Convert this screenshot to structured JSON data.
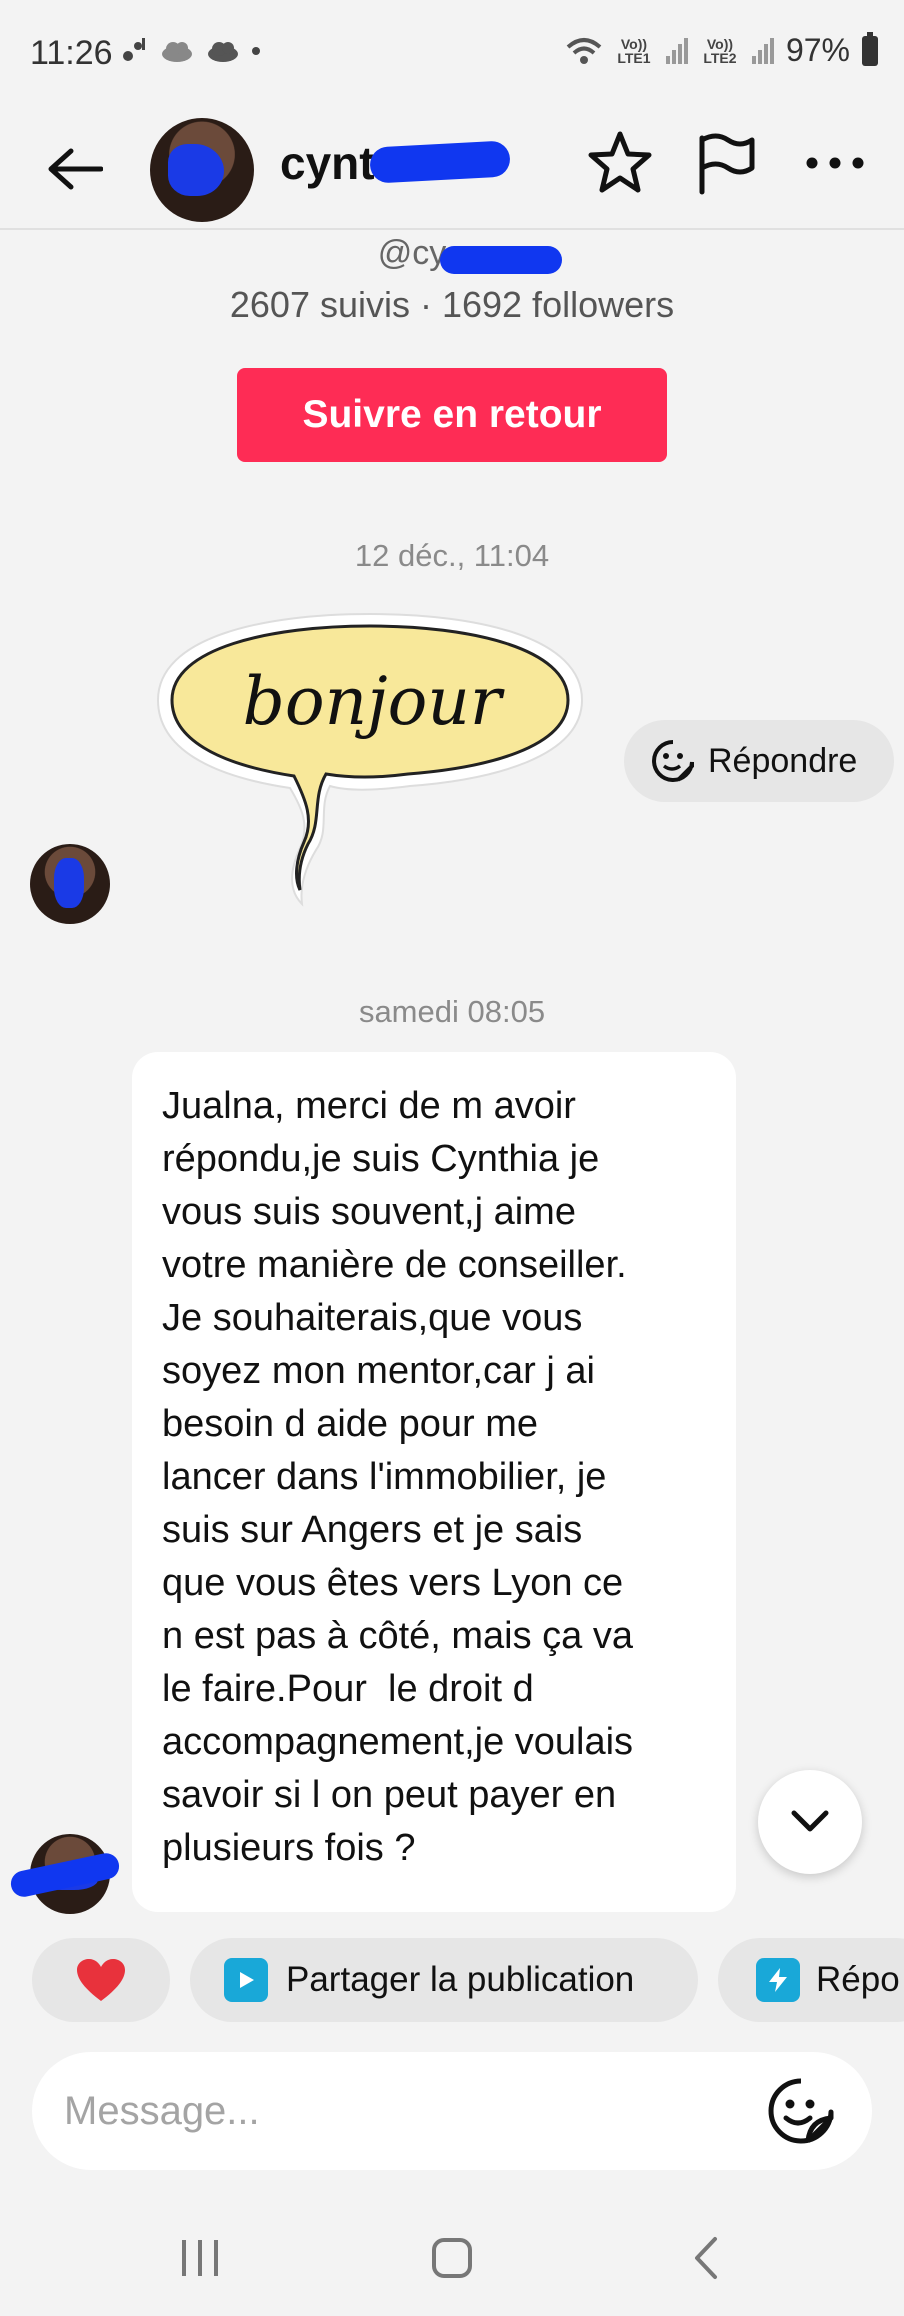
{
  "status_bar": {
    "time": "11:26",
    "left_icons": [
      "notification-icon",
      "cloud-icon",
      "cloud-icon",
      "dot-icon"
    ],
    "sim1_tag": "Vo)) LTE1",
    "sim2_tag": "Vo)) LTE2",
    "battery": "97%"
  },
  "header": {
    "username_visible": "cynt"
  },
  "profile": {
    "handle_visible": "@cy",
    "stats": "2607 suivis · 1692 followers"
  },
  "follow_back_label": "Suivre en retour",
  "timestamp_1": "12 déc., 11:04",
  "sticker_text": "bonjour",
  "reply_label": "Répondre",
  "timestamp_2": "samedi 08:05",
  "message_text": "Jualna, merci de m avoir\nrépondu,je suis Cynthia je\nvous suis souvent,j aime\nvotre manière de conseiller.\nJe souhaiterais,que vous\nsoyez mon mentor,car j ai\nbesoin d aide pour me\nlancer dans l'immobilier, je\nsuis sur Angers et je sais\nque vous êtes vers Lyon ce\nn est pas à côté, mais ça va\nle faire.Pour  le droit d\naccompagnement,je voulais\nsavoir si l on peut payer en\nplusieurs fois ?",
  "quick_replies": {
    "heart": "❤️",
    "share": "Partager la publication",
    "reply_partial": "Répo"
  },
  "composer": {
    "placeholder": "Message..."
  },
  "colors": {
    "accent": "#fe2c55",
    "redaction": "#1037f0",
    "share_icon": "#19a8d8"
  }
}
